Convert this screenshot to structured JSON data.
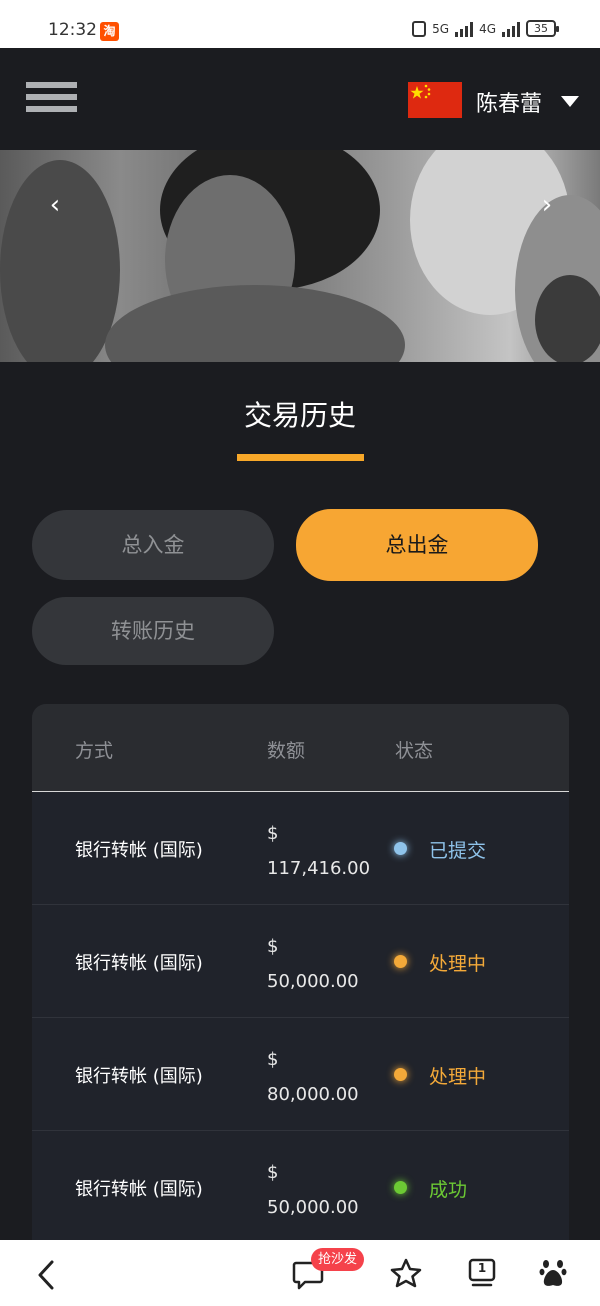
{
  "status_bar": {
    "time": "12:32",
    "app_badge": "淘",
    "network_1": "5G",
    "network_2": "4G",
    "battery": "35"
  },
  "header": {
    "user_name": "陈春蕾",
    "flag": "china-flag-icon"
  },
  "banner": {
    "prev": "‹",
    "next": "›"
  },
  "page": {
    "title": "交易历史"
  },
  "tabs": [
    {
      "label": "总入金",
      "active": false
    },
    {
      "label": "总出金",
      "active": true
    },
    {
      "label": "转账历史",
      "active": false
    }
  ],
  "table": {
    "headers": [
      "方式",
      "数额",
      "状态"
    ],
    "rows": [
      {
        "method": "银行转帐 (国际)",
        "currency": "$",
        "amount": "117,416.00",
        "status": "已提交",
        "status_color": "#8fc3ea"
      },
      {
        "method": "银行转帐 (国际)",
        "currency": "$",
        "amount": "50,000.00",
        "status": "处理中",
        "status_color": "#f3a939"
      },
      {
        "method": "银行转帐 (国际)",
        "currency": "$",
        "amount": "80,000.00",
        "status": "处理中",
        "status_color": "#f3a939"
      },
      {
        "method": "银行转帐 (国际)",
        "currency": "$",
        "amount": "50,000.00",
        "status": "成功",
        "status_color": "#6cc934"
      }
    ]
  },
  "bottom_nav": {
    "badge": "抢沙发",
    "tab_count": "1"
  },
  "colors": {
    "accent": "#f7a633",
    "background": "#1b1c20"
  }
}
